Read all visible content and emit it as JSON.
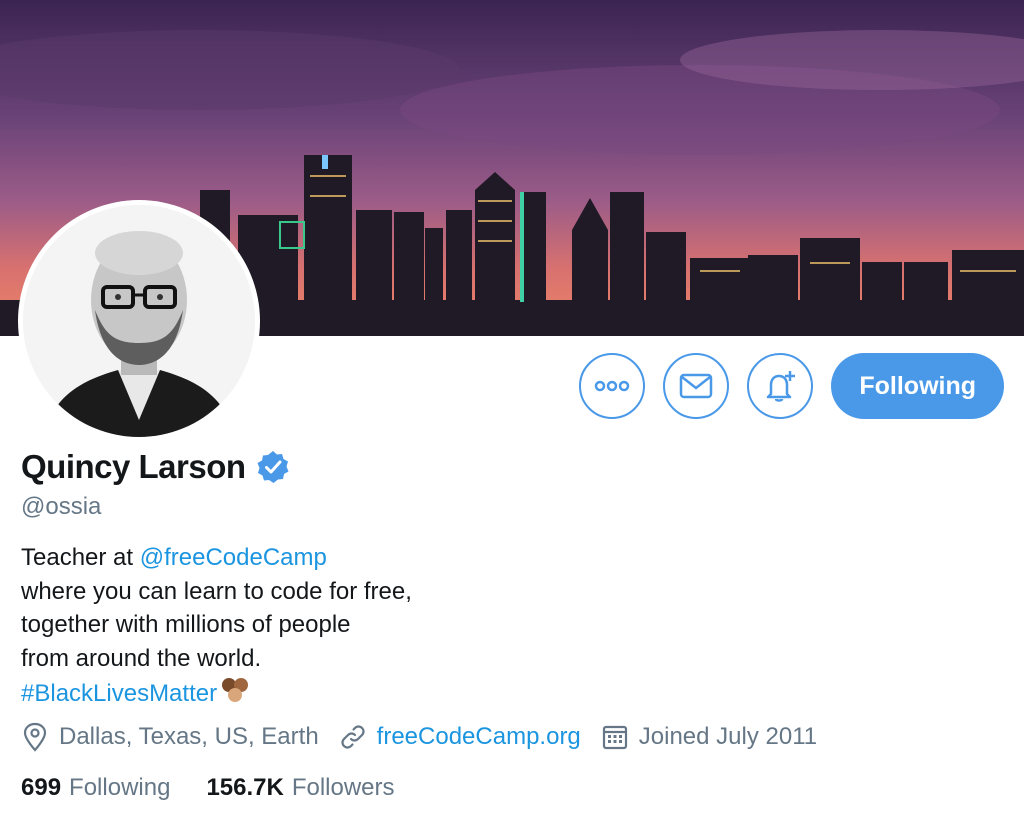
{
  "profile": {
    "name": "Quincy Larson",
    "handle": "@ossia",
    "bio": {
      "line1_prefix": "Teacher at ",
      "line1_mention": "@freeCodeCamp",
      "line2": "where you can learn to code for free,",
      "line3": "together with millions of people",
      "line4": "from around the world.",
      "hashtag": "#BlackLivesMatter"
    },
    "location": "Dallas, Texas, US, Earth",
    "website": "freeCodeCamp.org",
    "joined": "Joined July 2011"
  },
  "stats": {
    "following_count": "699",
    "following_label": "Following",
    "followers_count": "156.7K",
    "followers_label": "Followers"
  },
  "actions": {
    "follow_label": "Following"
  },
  "icons": {
    "more": "more-icon",
    "message": "mail-icon",
    "notify": "bell-plus-icon",
    "verified": "verified-badge-icon",
    "location": "location-pin-icon",
    "link": "link-icon",
    "calendar": "calendar-icon"
  },
  "colors": {
    "accent": "#4a99e9",
    "link": "#1b95e0",
    "muted": "#657786",
    "text": "#14171a"
  }
}
